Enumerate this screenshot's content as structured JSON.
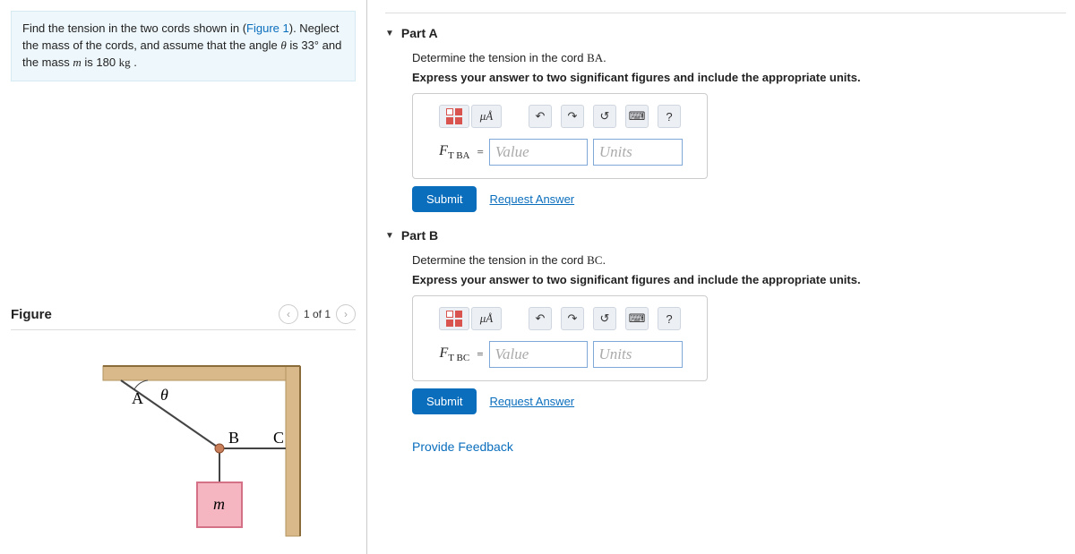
{
  "problem": {
    "text_before_link": "Find the tension in the two cords shown in (",
    "link_text": "Figure 1",
    "text_after_link": "). Neglect the mass of the cords, and assume that the angle ",
    "theta_html": "θ",
    "angle_text": " is 33° ",
    "mid_text": "and the mass ",
    "mass_var": "m",
    "mass_text": " is 180 ",
    "mass_unit": "kg",
    "end_text": " ."
  },
  "figure": {
    "heading": "Figure",
    "pager": "1 of 1",
    "labels": {
      "A": "A",
      "B": "B",
      "C": "C",
      "theta": "θ",
      "m": "m"
    }
  },
  "partA": {
    "title": "Part A",
    "q1_before": "Determine the tension in the cord ",
    "q1_cord": "BA",
    "q1_after": ".",
    "instr": "Express your answer to two significant figures and include the appropriate units.",
    "var_label": "F",
    "var_sub": "T BA",
    "equals": "=",
    "value_ph": "Value",
    "units_ph": "Units",
    "submit": "Submit",
    "request": "Request Answer"
  },
  "partB": {
    "title": "Part B",
    "q1_before": "Determine the tension in the cord ",
    "q1_cord": "BC",
    "q1_after": ".",
    "instr": "Express your answer to two significant figures and include the appropriate units.",
    "var_label": "F",
    "var_sub": "T BC",
    "equals": "=",
    "value_ph": "Value",
    "units_ph": "Units",
    "submit": "Submit",
    "request": "Request Answer"
  },
  "toolbar": {
    "mu_a": "μÅ",
    "help": "?"
  },
  "feedback": "Provide Feedback"
}
